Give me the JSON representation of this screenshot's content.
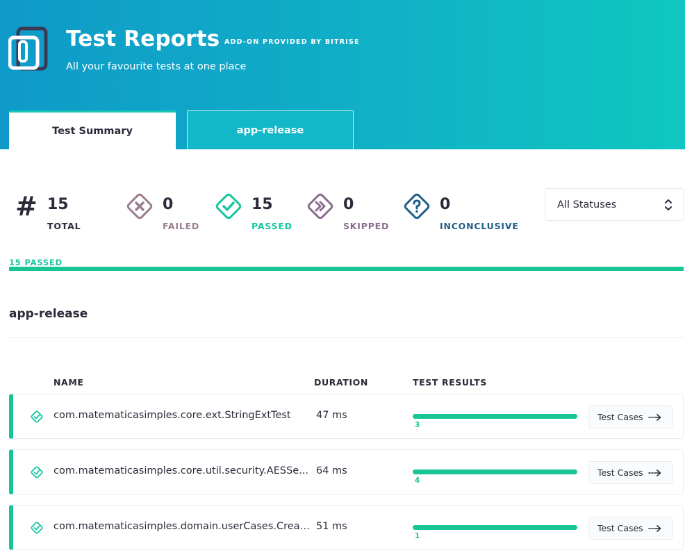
{
  "header": {
    "title": "Test Reports",
    "addon_label": "ADD-ON PROVIDED BY BITRISE",
    "subtitle": "All your favourite tests at one place"
  },
  "tabs": [
    {
      "label": "Test Summary",
      "active": true
    },
    {
      "label": "app-release",
      "active": false
    }
  ],
  "summary": {
    "total": {
      "value": "15",
      "label": "TOTAL",
      "icon": "hash-icon",
      "color": "#2b2a3a"
    },
    "failed": {
      "value": "0",
      "label": "FAILED",
      "icon": "x-diamond-icon",
      "color": "#9b7e8f"
    },
    "passed": {
      "value": "15",
      "label": "PASSED",
      "icon": "check-diamond-icon",
      "color": "#17c5a0"
    },
    "skipped": {
      "value": "0",
      "label": "SKIPPED",
      "icon": "skip-diamond-icon",
      "color": "#8b6b8f"
    },
    "inconclusive": {
      "value": "0",
      "label": "INCONCLUSIVE",
      "icon": "question-diamond-icon",
      "color": "#1f5f87"
    }
  },
  "filter": {
    "selected": "All Statuses"
  },
  "progress": {
    "caption": "15 PASSED",
    "passed_fraction": 1.0
  },
  "section": {
    "title": "app-release"
  },
  "table": {
    "columns": {
      "name": "NAME",
      "duration": "DURATION",
      "results": "TEST RESULTS"
    },
    "rows": [
      {
        "name": "com.matematicasimples.core.ext.StringExtTest",
        "duration": "47 ms",
        "count": "3",
        "passed_fraction": 1.0,
        "button": "Test Cases"
      },
      {
        "name": "com.matematicasimples.core.util.security.AESSe...",
        "duration": "64 ms",
        "count": "4",
        "passed_fraction": 1.0,
        "button": "Test Cases"
      },
      {
        "name": "com.matematicasimples.domain.userCases.Creat...",
        "duration": "51 ms",
        "count": "1",
        "passed_fraction": 1.0,
        "button": "Test Cases"
      }
    ]
  },
  "colors": {
    "accent_green": "#17c595",
    "header_gradient_start": "#0f9ac9",
    "header_gradient_end": "#0fc7c0"
  }
}
